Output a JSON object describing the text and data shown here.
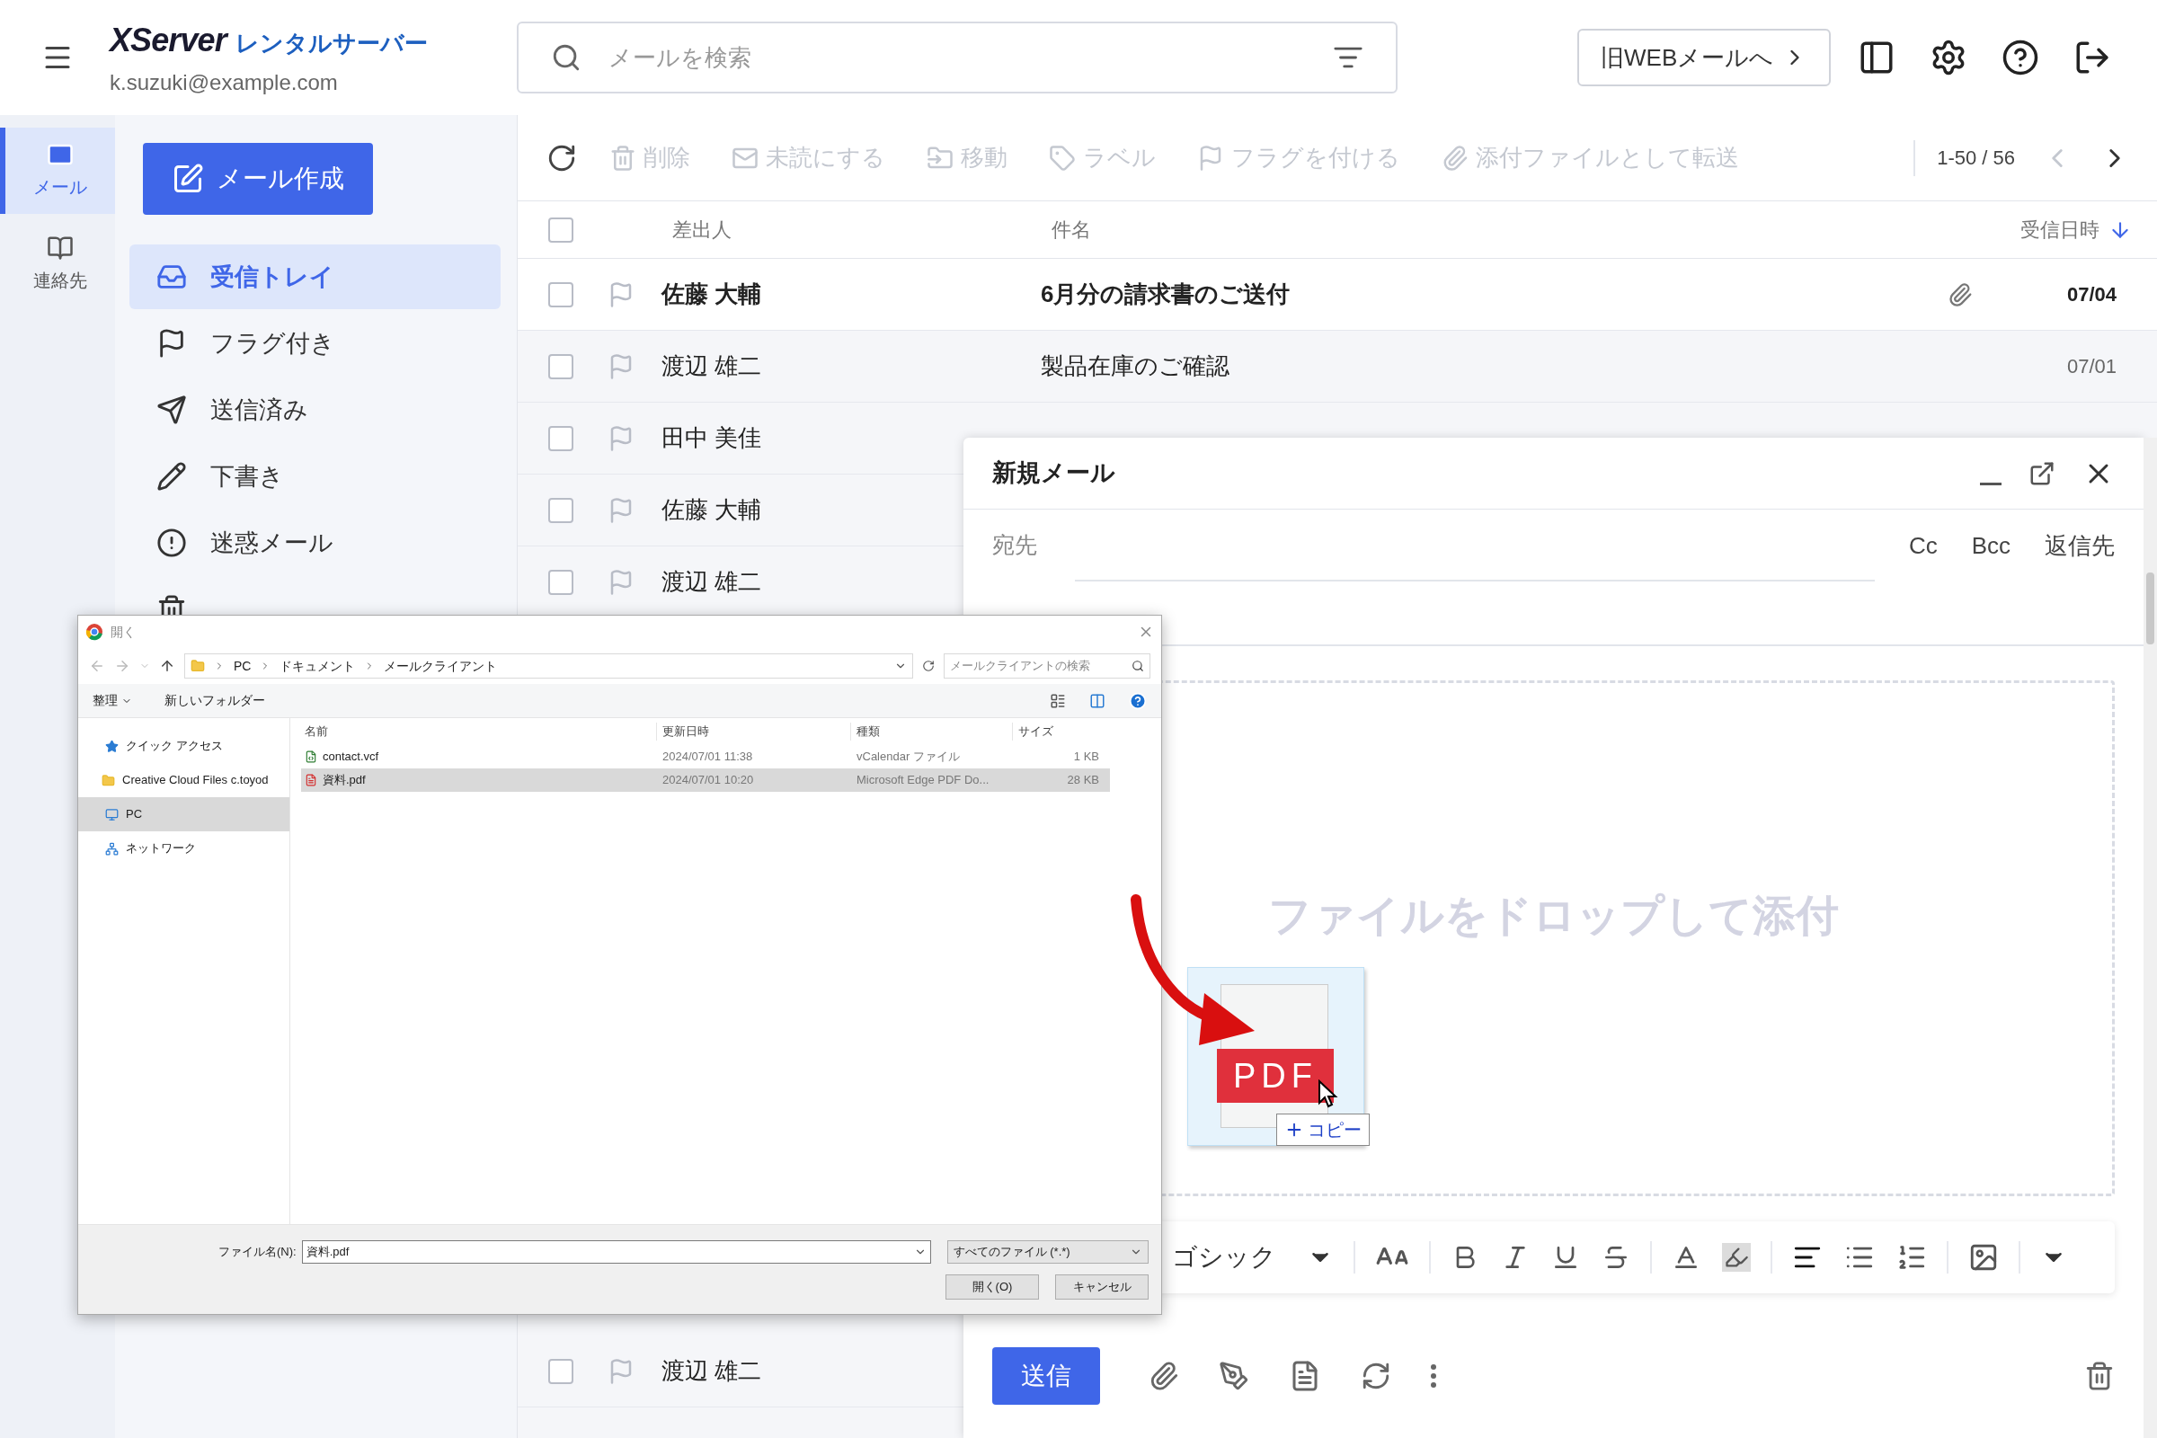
{
  "header": {
    "logo_main": "XServer",
    "logo_sub": "レンタルサーバー",
    "account": "k.suzuki@example.com",
    "search": {
      "placeholder": "メールを検索"
    },
    "legacy_button": "旧WEBメールへ"
  },
  "rail": [
    {
      "label": "メール",
      "selected": true
    },
    {
      "label": "連絡先",
      "selected": false
    }
  ],
  "compose_button": "メール作成",
  "folders": [
    {
      "label": "受信トレイ",
      "selected": true
    },
    {
      "label": "フラグ付き",
      "selected": false
    },
    {
      "label": "送信済み",
      "selected": false
    },
    {
      "label": "下書き",
      "selected": false
    },
    {
      "label": "迷惑メール",
      "selected": false
    }
  ],
  "toolbar": {
    "actions": [
      {
        "label": "削除",
        "disabled": true
      },
      {
        "label": "未読にする",
        "disabled": true
      },
      {
        "label": "移動",
        "disabled": true
      },
      {
        "label": "ラベル",
        "disabled": true
      },
      {
        "label": "フラグを付ける",
        "disabled": true
      },
      {
        "label": "添付ファイルとして転送",
        "disabled": true
      }
    ],
    "pagination": "1-50 / 56"
  },
  "columns": {
    "select_all": false,
    "sender": "差出人",
    "subject": "件名",
    "date": "受信日時"
  },
  "rows_top": [
    {
      "sender": "佐藤 大輔",
      "subject": "6月分の請求書のご送付",
      "date": "07/04",
      "unread": true,
      "attachment": true,
      "checked": false,
      "flagged": false
    },
    {
      "sender": "渡辺 雄二",
      "subject": "製品在庫のご確認",
      "date": "07/01",
      "unread": false,
      "checked": false,
      "flagged": false
    },
    {
      "sender": "田中 美佳",
      "unread": false,
      "checked": false,
      "flagged": false
    },
    {
      "sender": "佐藤 大輔",
      "unread": false,
      "checked": false,
      "flagged": false
    },
    {
      "sender": "渡辺 雄二",
      "unread": false,
      "checked": false,
      "flagged": false
    }
  ],
  "rows_bottom": [
    {
      "sender": "渡辺 雄二",
      "unread": false,
      "checked": false,
      "flagged": false
    }
  ],
  "compose": {
    "title": "新規メール",
    "to_label": "宛先",
    "recipient_options": [
      "Cc",
      "Bcc",
      "返信先"
    ],
    "drop_hint": "ファイルをドロップして添付",
    "font": "ゴシック",
    "send": "送信"
  },
  "file_dialog": {
    "title": "開く",
    "path": [
      "PC",
      "ドキュメント",
      "メールクライアント"
    ],
    "search": {
      "placeholder": "メールクライアントの検索"
    },
    "organize": "整理",
    "new_folder": "新しいフォルダー",
    "nav": [
      {
        "label": "クイック アクセス",
        "kind": "star",
        "selected": false
      },
      {
        "label": "Creative Cloud Files  c.toyod",
        "kind": "folder",
        "selected": false
      },
      {
        "label": "PC",
        "kind": "pc",
        "selected": true
      },
      {
        "label": "ネットワーク",
        "kind": "network",
        "selected": false
      }
    ],
    "columns": [
      "名前",
      "更新日時",
      "種類",
      "サイズ"
    ],
    "files": [
      {
        "name": "contact.vcf",
        "modified": "2024/07/01 11:38",
        "type": "vCalendar ファイル",
        "size": "1 KB",
        "kind": "vcf",
        "selected": false
      },
      {
        "name": "資料.pdf",
        "modified": "2024/07/01 10:20",
        "type": "Microsoft Edge PDF Do...",
        "size": "28 KB",
        "kind": "pdf",
        "selected": true
      }
    ],
    "filename_label": "ファイル名(N):",
    "filename": "資料.pdf",
    "filter": "すべてのファイル (*.*)",
    "open": "開く(O)",
    "cancel": "キャンセル"
  },
  "drag": {
    "file_label": "PDF",
    "effect": "コピー"
  }
}
